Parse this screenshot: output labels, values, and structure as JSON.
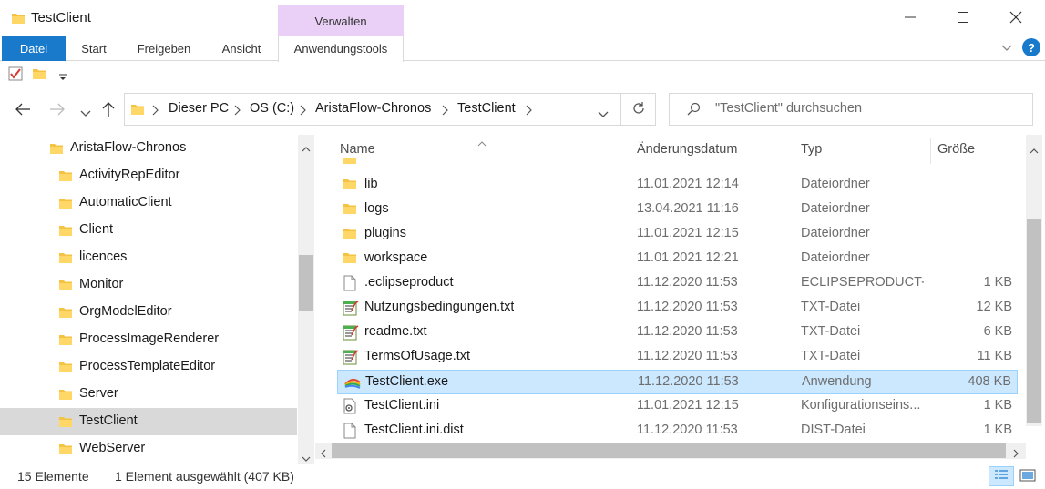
{
  "window": {
    "title": "TestClient",
    "context_tab_group": "Verwalten"
  },
  "ribbon": {
    "tabs": [
      "Datei",
      "Start",
      "Freigeben",
      "Ansicht",
      "Anwendungstools"
    ]
  },
  "breadcrumb": [
    "Dieser PC",
    "OS (C:)",
    "AristaFlow-Chronos",
    "TestClient"
  ],
  "search": {
    "placeholder": "\"TestClient\" durchsuchen"
  },
  "tree": {
    "items": [
      {
        "label": "AristaFlow-Chronos",
        "level": 0,
        "selected": false
      },
      {
        "label": "ActivityRepEditor",
        "level": 1,
        "selected": false
      },
      {
        "label": "AutomaticClient",
        "level": 1,
        "selected": false
      },
      {
        "label": "Client",
        "level": 1,
        "selected": false
      },
      {
        "label": "licences",
        "level": 1,
        "selected": false
      },
      {
        "label": "Monitor",
        "level": 1,
        "selected": false
      },
      {
        "label": "OrgModelEditor",
        "level": 1,
        "selected": false
      },
      {
        "label": "ProcessImageRenderer",
        "level": 1,
        "selected": false
      },
      {
        "label": "ProcessTemplateEditor",
        "level": 1,
        "selected": false
      },
      {
        "label": "Server",
        "level": 1,
        "selected": false
      },
      {
        "label": "TestClient",
        "level": 1,
        "selected": true
      },
      {
        "label": "WebServer",
        "level": 1,
        "selected": false
      }
    ]
  },
  "columns": {
    "name": "Name",
    "date": "Änderungsdatum",
    "type": "Typ",
    "size": "Größe"
  },
  "files": [
    {
      "name": "lib",
      "date": "11.01.2021 12:14",
      "type": "Dateiordner",
      "size": "",
      "icon": "folder",
      "selected": false
    },
    {
      "name": "logs",
      "date": "13.04.2021 11:16",
      "type": "Dateiordner",
      "size": "",
      "icon": "folder",
      "selected": false
    },
    {
      "name": "plugins",
      "date": "11.01.2021 12:15",
      "type": "Dateiordner",
      "size": "",
      "icon": "folder",
      "selected": false
    },
    {
      "name": "workspace",
      "date": "11.01.2021 12:21",
      "type": "Dateiordner",
      "size": "",
      "icon": "folder",
      "selected": false
    },
    {
      "name": ".eclipseproduct",
      "date": "11.12.2020 11:53",
      "type": "ECLIPSEPRODUCT-...",
      "size": "1 KB",
      "icon": "file",
      "selected": false
    },
    {
      "name": "Nutzungsbedingungen.txt",
      "date": "11.12.2020 11:53",
      "type": "TXT-Datei",
      "size": "12 KB",
      "icon": "text",
      "selected": false
    },
    {
      "name": "readme.txt",
      "date": "11.12.2020 11:53",
      "type": "TXT-Datei",
      "size": "6 KB",
      "icon": "text",
      "selected": false
    },
    {
      "name": "TermsOfUsage.txt",
      "date": "11.12.2020 11:53",
      "type": "TXT-Datei",
      "size": "11 KB",
      "icon": "text",
      "selected": false
    },
    {
      "name": "TestClient.exe",
      "date": "11.12.2020 11:53",
      "type": "Anwendung",
      "size": "408 KB",
      "icon": "exe",
      "selected": true
    },
    {
      "name": "TestClient.ini",
      "date": "11.01.2021 12:15",
      "type": "Konfigurationseins...",
      "size": "1 KB",
      "icon": "ini",
      "selected": false
    },
    {
      "name": "TestClient.ini.dist",
      "date": "11.12.2020 11:53",
      "type": "DIST-Datei",
      "size": "1 KB",
      "icon": "file",
      "selected": false
    }
  ],
  "status": {
    "count": "15 Elemente",
    "selection": "1 Element ausgewählt (407 KB)"
  },
  "colors": {
    "accent": "#1979ca",
    "context_tab": "#ead0f7",
    "selection": "#cce8ff",
    "folder": "#f5c342"
  }
}
